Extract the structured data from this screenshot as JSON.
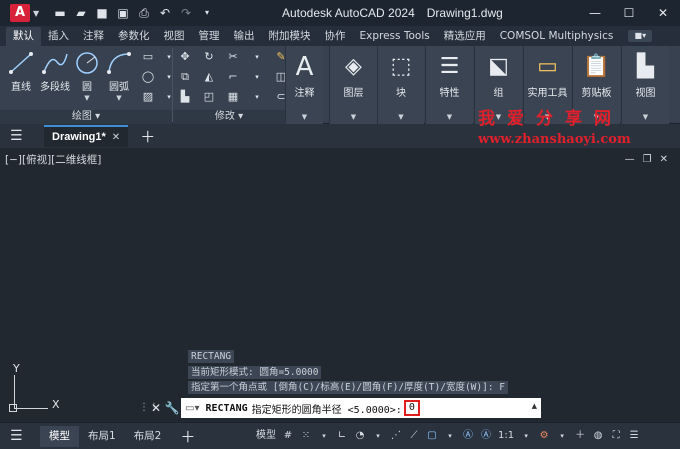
{
  "titlebar": {
    "app_letter": "A",
    "app_name": "Autodesk AutoCAD 2024",
    "doc_name": "Drawing1.dwg",
    "qat_icons": [
      "new-icon",
      "open-icon",
      "save-icon",
      "save-as-icon",
      "print-icon",
      "undo-icon",
      "redo-icon",
      "customize-icon"
    ],
    "window_controls": [
      "minimize",
      "maximize",
      "close"
    ]
  },
  "ribbon_tabs": [
    "默认",
    "插入",
    "注释",
    "参数化",
    "视图",
    "管理",
    "输出",
    "附加模块",
    "协作",
    "Express Tools",
    "精选应用",
    "COMSOL Multiphysics"
  ],
  "ribbon": {
    "draw_panel": {
      "title": "绘图",
      "tools": [
        "直线",
        "多段线",
        "圆",
        "圆弧"
      ]
    },
    "modify_panel": {
      "title": "修改"
    },
    "big_panels": [
      "注释",
      "图层",
      "块",
      "特性",
      "组",
      "实用工具",
      "剪贴板",
      "视图"
    ]
  },
  "file_tabs": {
    "active": "Drawing1*"
  },
  "watermark": {
    "line1": "我爱分享网",
    "line2": "www.zhanshaoyi.com"
  },
  "viewport": {
    "label": "[−][俯视][二维线框]"
  },
  "ucs": {
    "x": "X",
    "y": "Y"
  },
  "history": [
    "RECTANG",
    "当前矩形模式:  圆角=5.0000",
    "指定第一个角点或 [倒角(C)/标高(E)/圆角(F)/厚度(T)/宽度(W)]: F"
  ],
  "command": {
    "name": "RECTANG",
    "prompt": "指定矩形的圆角半径 <5.0000>:",
    "value": "0"
  },
  "status": {
    "layouts": [
      "模型",
      "布局1",
      "布局2"
    ],
    "model_label": "模型",
    "scale": "1:1"
  },
  "colors": {
    "accent_red": "#e21d1d",
    "app_red": "#d8223a",
    "background": "#212830"
  }
}
